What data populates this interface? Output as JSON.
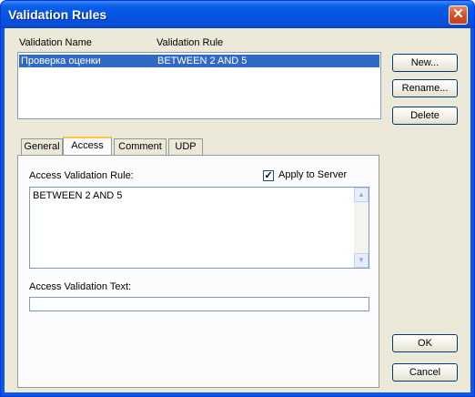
{
  "window": {
    "title": "Validation Rules"
  },
  "list": {
    "columns": [
      "Validation Name",
      "Validation Rule"
    ],
    "rows": [
      {
        "name": "Проверка оценки",
        "rule": "BETWEEN 2 AND 5",
        "selected": true
      }
    ]
  },
  "side_buttons": {
    "new": "New...",
    "rename": "Rename...",
    "delete": "Delete"
  },
  "tabs": [
    {
      "label": "General",
      "active": false
    },
    {
      "label": "Access",
      "active": true
    },
    {
      "label": "Comment",
      "active": false
    },
    {
      "label": "UDP",
      "active": false
    }
  ],
  "access": {
    "rule_label": "Access Validation Rule:",
    "apply_to_server_label": "Apply to Server",
    "apply_to_server_checked": true,
    "rule_value": "BETWEEN 2 AND 5",
    "text_label": "Access Validation Text:",
    "text_value": ""
  },
  "footer": {
    "ok": "OK",
    "cancel": "Cancel"
  },
  "icons": {
    "close": "close-icon",
    "check": "checkmark-icon",
    "scroll_up": "scroll-up-arrow-icon",
    "scroll_down": "scroll-down-arrow-icon"
  }
}
